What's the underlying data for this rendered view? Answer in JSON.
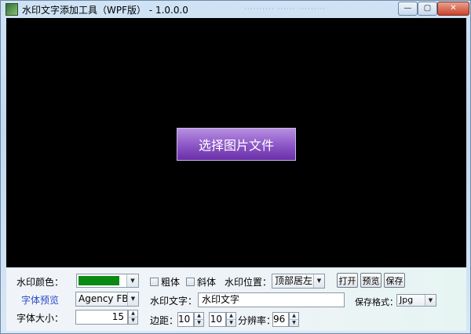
{
  "window": {
    "title": "水印文字添加工具（WPF版） - 1.0.0.0",
    "faint_title": "·········· ······ ·········"
  },
  "window_controls": {
    "minimize": "—",
    "maximize": "▢",
    "close": "✕"
  },
  "canvas": {
    "select_image_label": "选择图片文件"
  },
  "controls": {
    "watermark_color_label": "水印颜色：",
    "watermark_color": "#0a8a12",
    "font_preview_label": "字体预览",
    "font_family": "Agency FB",
    "font_size_label": "字体大小：",
    "font_size": "15",
    "bold_label": "粗体",
    "italic_label": "斜体",
    "position_label": "水印位置：",
    "position_value": "顶部居左",
    "open_label": "打开",
    "preview_label": "预览",
    "save_label": "保存",
    "watermark_text_label": "水印文字：",
    "watermark_text": "水印文字",
    "save_format_label": "保存格式：",
    "save_format": "Jpg",
    "margin_label": "边距：",
    "margin_x": "10",
    "margin_y": "10",
    "resolution_label": "分辨率：",
    "resolution": "96"
  }
}
